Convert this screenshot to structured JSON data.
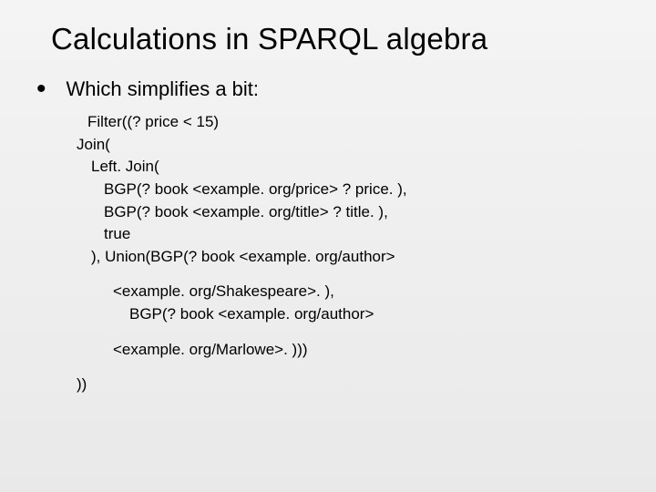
{
  "title": "Calculations in SPARQL algebra",
  "bullet": "Which simplifies a bit:",
  "code": {
    "l1": "Filter((? price < 15)",
    "l2": "Join(",
    "l3": "Left. Join(",
    "l4": "BGP(? book <example. org/price> ? price. ),",
    "l5": "BGP(? book <example. org/title> ? title. ),",
    "l6": "true",
    "l7": "), Union(BGP(? book <example. org/author>",
    "l8": "<example. org/Shakespeare>. ),",
    "l9": "BGP(? book <example. org/author>",
    "l10": "<example. org/Marlowe>. )))",
    "l11": "))"
  }
}
